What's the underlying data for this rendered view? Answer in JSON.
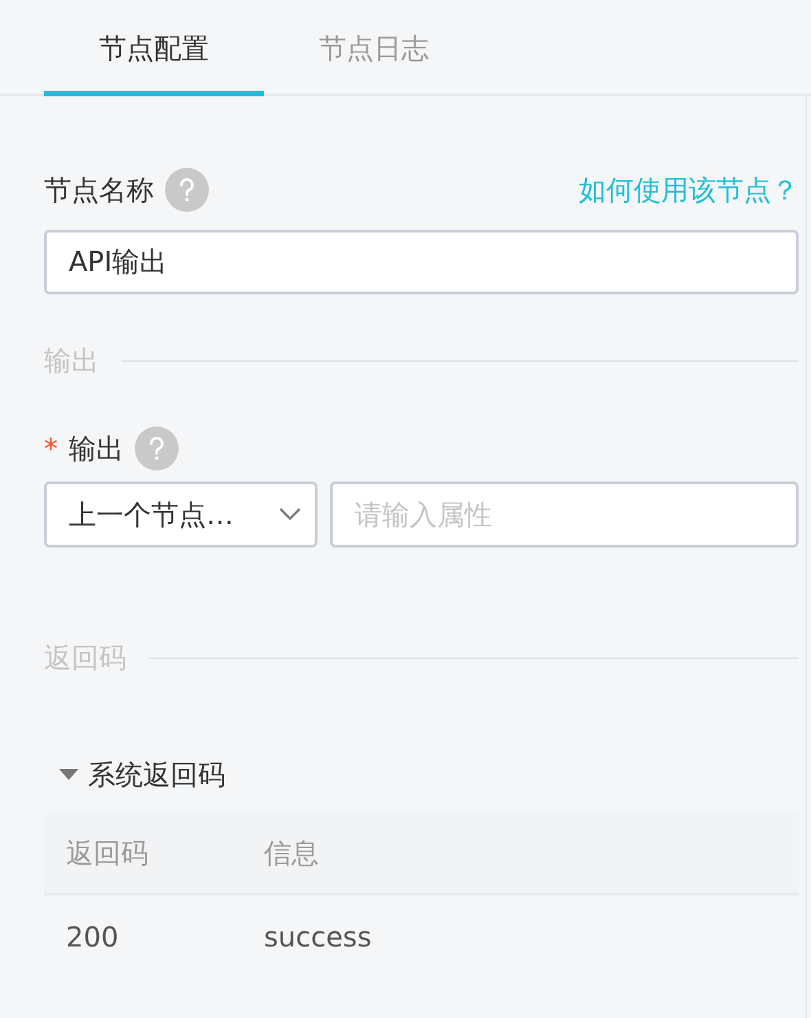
{
  "tabs": [
    {
      "label": "节点配置",
      "selected": true
    },
    {
      "label": "节点日志",
      "selected": false
    }
  ],
  "name_field": {
    "label": "节点名称",
    "help_link": "如何使用该节点？",
    "value": "API输出"
  },
  "output_section": {
    "title": "输出",
    "field": {
      "label": "输出",
      "required_mark": "*",
      "select_value": "上一个节点…",
      "placeholder": "请输入属性"
    }
  },
  "return_section": {
    "title": "返回码",
    "group": {
      "title": "系统返回码",
      "expanded": true,
      "table": {
        "columns": [
          "返回码",
          "信息"
        ],
        "rows": [
          [
            "200",
            "success"
          ]
        ]
      }
    }
  }
}
